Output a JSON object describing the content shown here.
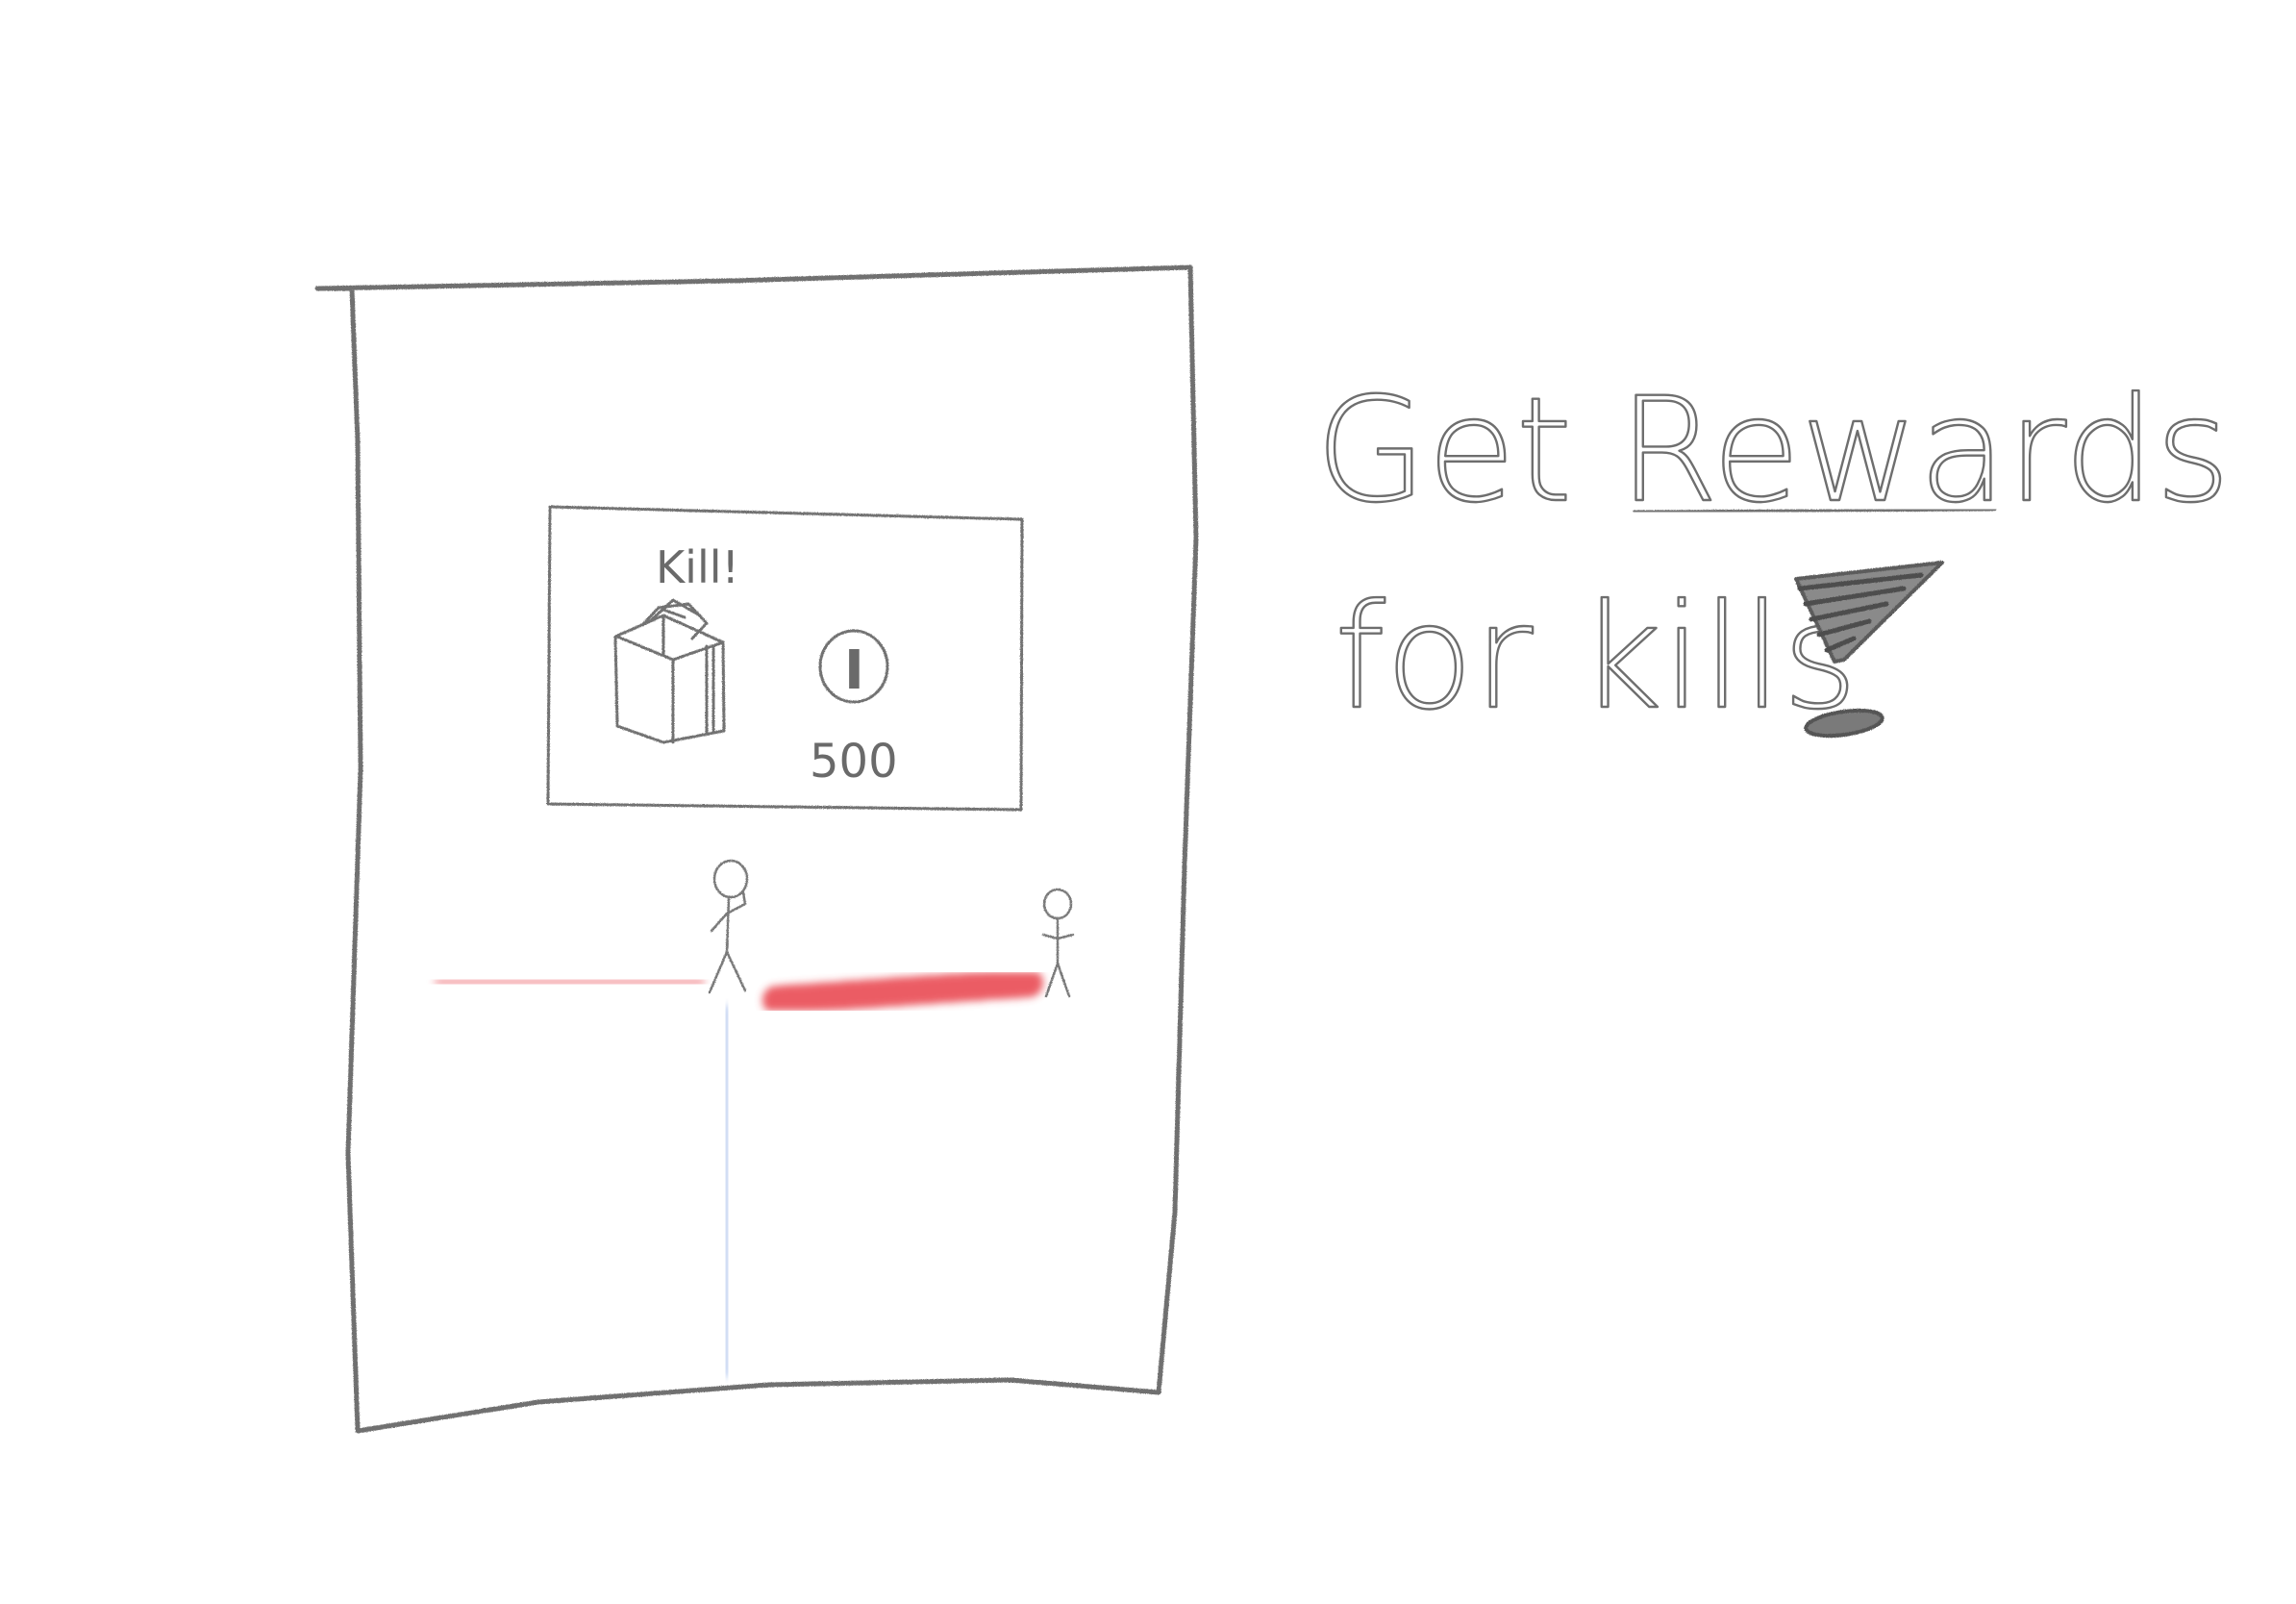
{
  "sketch": {
    "headline_line1": "Get Rewards",
    "headline_line2": "for kills",
    "reward_popup": {
      "title": "Kill!",
      "coin_symbol": "I",
      "coin_amount": "500"
    },
    "colors": {
      "pencil": "#6e6e6e",
      "red_path": "#e8404a",
      "blue_path": "#4a78d6"
    }
  }
}
